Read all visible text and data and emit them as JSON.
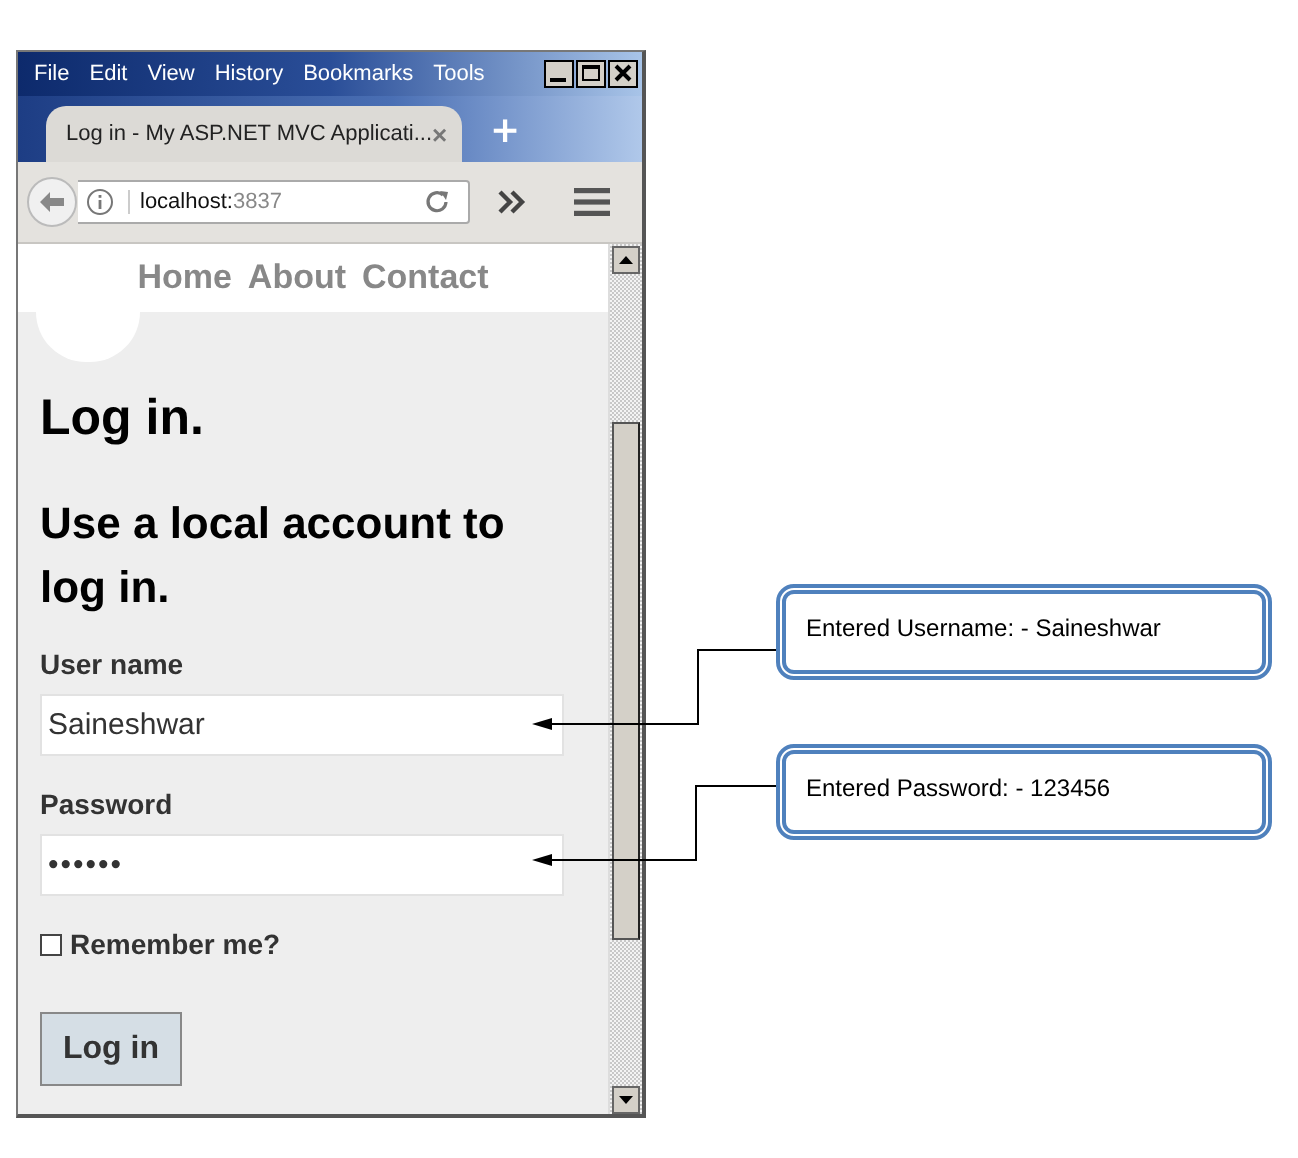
{
  "browser": {
    "menu": [
      "File",
      "Edit",
      "View",
      "History",
      "Bookmarks",
      "Tools"
    ],
    "tabs": [
      {
        "title": "Log in - My ASP.NET MVC Applicati...",
        "close": "×",
        "selected": true
      }
    ],
    "new_tab": "+",
    "address": {
      "host": "localhost:",
      "port": "3837"
    }
  },
  "page": {
    "nav": [
      "Home",
      "About",
      "Contact"
    ],
    "title": "Log in.",
    "subtitle": "Use a local account to log in.",
    "fields": [
      {
        "label": "User name",
        "value": "Saineshwar"
      },
      {
        "label": "Password",
        "value": "••••••"
      }
    ],
    "remember": {
      "label": "Remember me?",
      "checked": false
    },
    "button": "Log in"
  },
  "annotations": [
    {
      "text": "Entered Username: - Saineshwar"
    },
    {
      "text": "Entered Password: - 123456"
    }
  ]
}
